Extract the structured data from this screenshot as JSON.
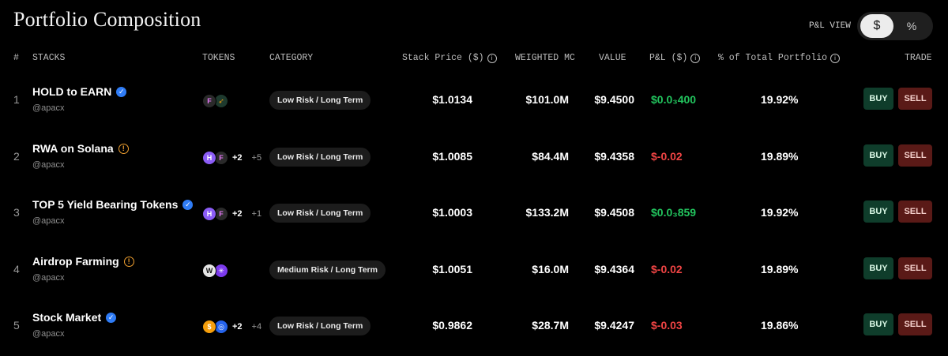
{
  "page": {
    "title": "Portfolio Composition"
  },
  "pnl_view": {
    "label": "P&L VIEW",
    "options": [
      "$",
      "%"
    ],
    "selected": "$"
  },
  "table": {
    "headers": {
      "index": "#",
      "stacks": "STACKS",
      "tokens": "TOKENS",
      "category": "CATEGORY",
      "stack_price": "Stack Price ($)",
      "weighted_mc": "WEIGHTED MC",
      "value": "VALUE",
      "pnl": "P&L ($)",
      "pct_portfolio": "% of Total Portfolio",
      "trade": "TRADE"
    },
    "buy_label": "BUY",
    "sell_label": "SELL",
    "rows": [
      {
        "index": "1",
        "name": "HOLD to EARN",
        "badge": "verified",
        "handle": "@apacx",
        "token_icons": [
          "f-token-icon",
          "rocket-token-icon"
        ],
        "tokens_plus": "",
        "tokens_more": "",
        "category": "Low Risk / Long Term",
        "price": "$1.0134",
        "mc": "$101.0M",
        "value": "$9.4500",
        "pnl": "$0.0₃400",
        "pnl_sign": "pos",
        "pct": "19.92%"
      },
      {
        "index": "2",
        "name": "RWA on Solana",
        "badge": "warning",
        "handle": "@apacx",
        "token_icons": [
          "h-token-icon",
          "f-token-icon"
        ],
        "tokens_plus": "+2",
        "tokens_more": "+5",
        "category": "Low Risk / Long Term",
        "price": "$1.0085",
        "mc": "$84.4M",
        "value": "$9.4358",
        "pnl": "$-0.02",
        "pnl_sign": "neg",
        "pct": "19.89%"
      },
      {
        "index": "3",
        "name": "TOP 5 Yield Bearing Tokens",
        "badge": "verified",
        "handle": "@apacx",
        "token_icons": [
          "h-token-icon",
          "f-token-icon"
        ],
        "tokens_plus": "+2",
        "tokens_more": "+1",
        "category": "Low Risk / Long Term",
        "price": "$1.0003",
        "mc": "$133.2M",
        "value": "$9.4508",
        "pnl": "$0.0₃859",
        "pnl_sign": "pos",
        "pct": "19.92%"
      },
      {
        "index": "4",
        "name": "Airdrop Farming",
        "badge": "warning",
        "handle": "@apacx",
        "token_icons": [
          "bird-token-icon",
          "asterisk-token-icon"
        ],
        "tokens_plus": "",
        "tokens_more": "",
        "category": "Medium Risk / Long Term",
        "price": "$1.0051",
        "mc": "$16.0M",
        "value": "$9.4364",
        "pnl": "$-0.02",
        "pnl_sign": "neg",
        "pct": "19.89%"
      },
      {
        "index": "5",
        "name": "Stock Market",
        "badge": "verified",
        "handle": "@apacx",
        "token_icons": [
          "dollar-token-icon",
          "circle-token-icon"
        ],
        "tokens_plus": "+2",
        "tokens_more": "+4",
        "category": "Low Risk / Long Term",
        "price": "$0.9862",
        "mc": "$28.7M",
        "value": "$9.4247",
        "pnl": "$-0.03",
        "pnl_sign": "neg",
        "pct": "19.86%"
      }
    ]
  },
  "colors": {
    "positive": "#22c55e",
    "negative": "#ef4444",
    "buy_bg": "#0f3d2b",
    "sell_bg": "#5a1a17",
    "verified": "#2f7cf6",
    "warning": "#f0a030"
  }
}
